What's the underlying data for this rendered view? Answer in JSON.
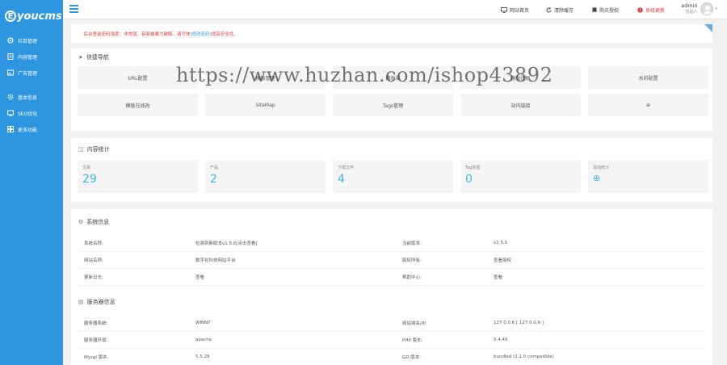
{
  "sidebar": {
    "logo": "youcms",
    "logo_mark": "E",
    "items": [
      {
        "label": "栏目管理",
        "icon": "gear-icon"
      },
      {
        "label": "内容管理",
        "icon": "document-icon"
      },
      {
        "label": "广告管理",
        "icon": "image-icon"
      },
      {
        "label": "基本信息",
        "icon": "settings-icon"
      },
      {
        "label": "SEO优化",
        "icon": "seo-icon"
      },
      {
        "label": "更多功能",
        "icon": "grid-icon"
      }
    ]
  },
  "header": {
    "links": [
      {
        "label": "网站首页",
        "icon": "monitor-icon"
      },
      {
        "label": "清除缓存",
        "icon": "refresh-icon"
      },
      {
        "label": "购买授权",
        "icon": "bookmark-icon"
      },
      {
        "label": "系统更新",
        "icon": "alert-icon"
      }
    ],
    "user_name": "admin",
    "user_role": "创始人"
  },
  "notice": {
    "text_before": "· 后台登录密码强度：非常弱，容易被暴力破解，请尽快",
    "link": "[修改密码]",
    "text_after": "提高安全性。"
  },
  "quick_nav": {
    "title": "快捷导航",
    "items": [
      "URL配置",
      "模板管理",
      "回收站",
      "备份还原",
      "水印配置",
      "模板在线改",
      "SiteMap",
      "Tags管理",
      "站内链接",
      "⊕"
    ]
  },
  "stats": {
    "title": "内容统计",
    "items": [
      {
        "label": "文章",
        "value": "29"
      },
      {
        "label": "产品",
        "value": "2"
      },
      {
        "label": "下载文件",
        "value": "4"
      },
      {
        "label": "Tag标签",
        "value": "0"
      },
      {
        "label": "添加统计",
        "value": "⊕"
      }
    ]
  },
  "system": {
    "title": "系统信息",
    "rows": [
      {
        "k1": "系统名称:",
        "v1": "检测到新版本v1.5.6[点击查看]",
        "k2": "当前版本:",
        "v2": "v1.5.5"
      },
      {
        "k1": "网站名称:",
        "v1": "数字化科技网站平台",
        "k2": "版权所有:",
        "v2": "查看授权"
      },
      {
        "k1": "更新日志:",
        "v1": "查看",
        "k2": "帮助中心:",
        "v2": "查看"
      }
    ]
  },
  "server": {
    "title": "服务器信息",
    "rows": [
      {
        "k1": "服务器系统:",
        "v1": "WINNT",
        "k2": "网站域名/IP:",
        "v2": "127.0.0.6 [ 127.0.0.6 ]"
      },
      {
        "k1": "服务器环境:",
        "v1": "apache",
        "k2": "PHP 版本:",
        "v2": "5.4.45"
      },
      {
        "k1": "Mysql 版本:",
        "v1": "5.5.29",
        "k2": "GD 版本:",
        "v2": "bundled (2.1.0 compatible)"
      }
    ]
  },
  "watermark": "https://www.huzhan.com/ishop43892",
  "colors": {
    "sidebar": "#2e96e0",
    "accent": "#42b8dc",
    "alert": "#e03a3a"
  }
}
